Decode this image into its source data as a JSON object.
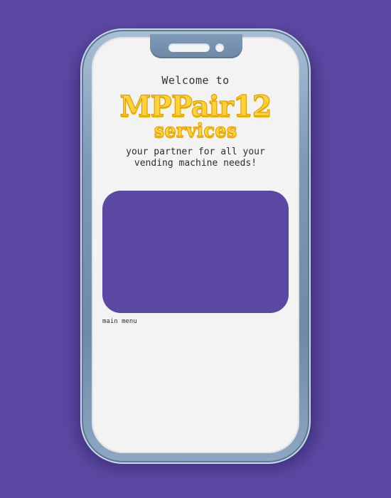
{
  "colors": {
    "background": "#5b48a3",
    "screen": "#f3f3f3",
    "frame": "#7f9ab6",
    "brand_fill": "#ffd23a",
    "brand_outline": "#e2a000",
    "panel": "#5b48a3",
    "text": "#2e2e2e"
  },
  "header": {
    "welcome": "Welcome to",
    "brand": "MPPair12",
    "services": "services",
    "tagline_line1": "your partner for all your",
    "tagline_line2": "vending machine needs!"
  },
  "main": {
    "menu_label": "main menu"
  },
  "icons": {
    "speaker": "speaker-slot-icon",
    "camera": "camera-icon"
  }
}
